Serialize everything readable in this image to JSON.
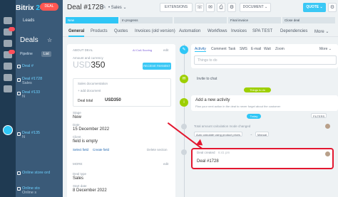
{
  "app": {
    "brand": "Bitrix",
    "brand_number": "24",
    "crm_pill": "DEAL",
    "menu": [
      "Leads",
      "Deals"
    ],
    "deals_title": "Deals",
    "pipeline": "Pipeline",
    "list_tab": "List"
  },
  "deals_list": [
    {
      "title": "Deal #",
      "sub": ""
    },
    {
      "title": "Deal #1728",
      "sub": "Sales"
    },
    {
      "title": "Deal #133",
      "sub": "N"
    },
    {
      "title": "Deal #135",
      "sub": "N"
    },
    {
      "title": "Online store ord",
      "sub": ""
    },
    {
      "title": "Online sto",
      "sub": "Online s"
    }
  ],
  "header": {
    "deal_title": "Deal #1728",
    "pipeline_label": "Sales",
    "extensions": "EXTENSIONS",
    "document": "DOCUMENT",
    "quote": "QUOTE"
  },
  "stages": [
    {
      "label": "New",
      "color": "#2fc6f6"
    },
    {
      "label": "In progress",
      "color": "#dbe3e8"
    },
    {
      "label": "",
      "color": "#dbe3e8"
    },
    {
      "label": "Final invoice",
      "color": "#dbe3e8"
    },
    {
      "label": "Close deal",
      "color": "#dbe3e8"
    }
  ],
  "tabs": [
    "General",
    "Products",
    "Quotes",
    "Invoices (old version)",
    "Automation",
    "Workflows",
    "Invoices",
    "SPA TEST",
    "Dependencies",
    "More"
  ],
  "about": {
    "section": "ABOUT DEAL",
    "ai_badge": "AI CoA Scoring",
    "edit": "edit",
    "amount_label": "Amount and currency",
    "amount_currency": "USD",
    "amount_value": "350",
    "receive_payment": "RECEIVE PAYMENT",
    "doc_label": "Sales documentation",
    "add_document": "+ add document",
    "deal_total_label": "Deal total",
    "deal_total_value": "USD350",
    "stage_label": "Stage",
    "stage_value": "New",
    "date_label": "Date",
    "date_value": "15 December 2022",
    "client_label": "Client",
    "client_value": "field is empty",
    "select_field": "Select field",
    "create_field": "Create field",
    "delete_section": "Delete section",
    "more_section": "MORE",
    "more_edit": "edit",
    "type_label": "Deal type",
    "type_value": "Sales",
    "date2_label": "Start date",
    "date2_value": "8 December 2022"
  },
  "activity": {
    "tabs": [
      "Activity",
      "Comment",
      "Task",
      "SMS",
      "E-mail",
      "Wait",
      "Zoom",
      "More"
    ],
    "todo_placeholder": "Things to do",
    "invite_chat": "Invite to chat",
    "things_to_do": "Things to do",
    "add_new_activity": "Add a new activity",
    "add_new_activity_hint": "Plan your next action in the deal to never forget about the customer",
    "today": "Today",
    "filter": "FILTERS",
    "amount_changed": "Total amount calculation mode changed",
    "auto_calc": "Auto calculate using product prices",
    "manual": "Manual",
    "deal_created_label": "Deal created",
    "deal_created_time": "6:41 pm",
    "deal_created_title": "Deal #1728"
  }
}
